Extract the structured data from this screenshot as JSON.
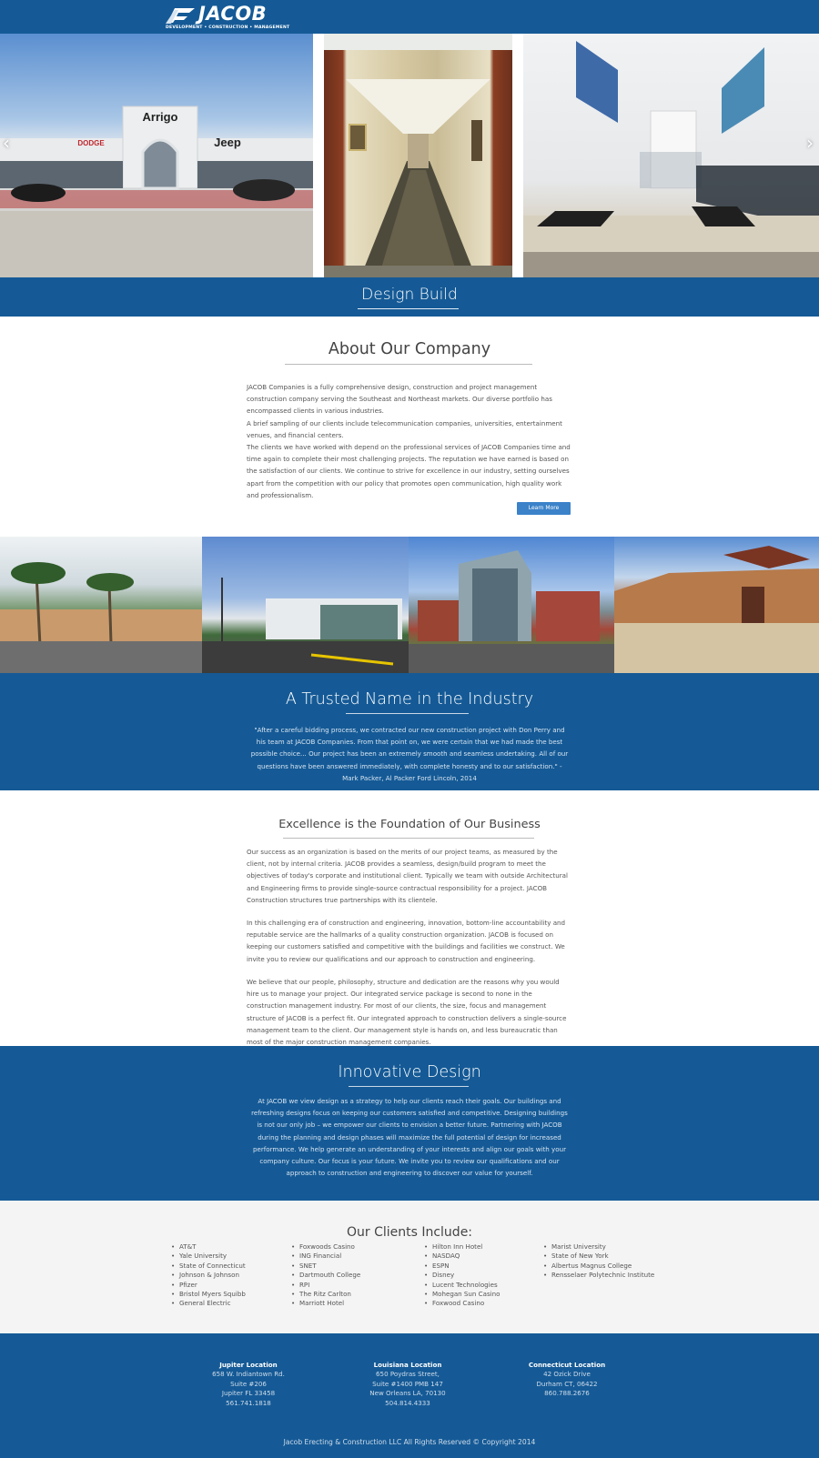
{
  "header": {
    "logo_text": "JACOB",
    "logo_tagline": "DEVELOPMENT • CONSTRUCTION • MANAGEMENT"
  },
  "hero": {
    "prev_icon": "chevron-left-icon",
    "next_icon": "chevron-right-icon",
    "banner": "Design Build",
    "images": [
      {
        "name": "dealership-photo",
        "signs": [
          "Arrigo",
          "DODGE",
          "Jeep"
        ]
      },
      {
        "name": "corridor-photo"
      },
      {
        "name": "lobby-photo"
      }
    ]
  },
  "about": {
    "title": "About Our Company",
    "text": "JACOB Companies is a fully comprehensive design, construction and project management construction company serving the Southeast and Northeast markets. Our diverse portfolio has encompassed clients in various industries.\nA brief sampling of our clients include telecommunication companies, universities, entertainment venues, and financial centers.\nThe clients we have worked with depend on the professional services of JACOB Companies time and time again to complete their most challenging projects. The reputation we have earned is based on the satisfaction of our clients. We continue to strive for excellence in our industry, setting ourselves apart from the competition with our policy that promotes open communication, high quality work and professionalism.",
    "button": "Learn More"
  },
  "trusted": {
    "title": "A Trusted Name in the Industry",
    "quote": "\"After a careful bidding process, we contracted our new construction project with Don Perry and his team at JACOB Companies. From that point on, we were certain that we had made the best possible choice... Our project has been an extremely smooth and seamless undertaking. All of our questions have been answered immediately, with complete honesty and to our satisfaction.\" - Mark Packer, Al Packer Ford Lincoln, 2014"
  },
  "excellence": {
    "title": "Excellence is the Foundation of Our Business",
    "p1": "Our success as an organization is based on the merits of our project teams, as measured by the client, not by internal criteria. JACOB provides a seamless, design/build program to meet the objectives of today's corporate and institutional client. Typically we team with outside Architectural and Engineering firms to provide single-source contractual responsibility for a project. JACOB Construction structures true partnerships with its clientele.",
    "p2": "In this challenging era of construction and engineering, innovation, bottom-line accountability and reputable service are the hallmarks of a quality construction organization. JACOB is focused on keeping our customers satisfied and competitive with the buildings and facilities we construct. We invite you to review our qualifications and our approach to construction and engineering.",
    "p3": "We believe that our people, philosophy, structure and dedication are the reasons why you would hire us to manage your project. Our integrated service package is second to none in the construction management industry. For most of our clients, the size, focus and management structure of JACOB is a perfect fit. Our integrated approach to construction delivers a single-source management team to the client. Our management style is hands on, and less bureaucratic than most of the major construction management companies."
  },
  "innovative": {
    "title": "Innovative Design",
    "text": "At JACOB we view design as a strategy to help our clients reach their goals. Our buildings and refreshing designs focus on keeping our customers satisfied and competitive. Designing buildings is not our only job – we empower our clients to envision a better future. Partnering with JACOB during the planning and design phases will maximize the full potential of design for increased performance. We help generate an understanding of your interests and align our goals with your company culture. Our focus is your future. We invite you to review our qualifications and our approach to construction and engineering to discover our value for yourself."
  },
  "clients": {
    "title": "Our Clients Include:",
    "columns": [
      [
        "AT&T",
        "Yale University",
        "State of Connecticut",
        "Johnson & Johnson",
        "Pfizer",
        "Bristol Myers Squibb",
        "General Electric"
      ],
      [
        "Foxwoods Casino",
        "ING Financial",
        "SNET",
        "Dartmouth College",
        "RPI",
        "The Ritz Carlton",
        "Marriott Hotel"
      ],
      [
        "Hilton Inn Hotel",
        "NASDAQ",
        "ESPN",
        "Disney",
        "Lucent Technologies",
        "Mohegan Sun Casino",
        "Foxwood Casino"
      ],
      [
        "Marist University",
        "State of New York",
        "Albertus Magnus College",
        "Rensselaer Polytechnic Institute"
      ]
    ]
  },
  "footer": {
    "locations": [
      {
        "title": "Jupiter Location",
        "lines": [
          "658 W. Indiantown Rd.",
          "Suite #206",
          "Jupiter FL 33458",
          "561.741.1818"
        ]
      },
      {
        "title": "Louisiana Location",
        "lines": [
          "650 Poydras Street,",
          "Suite #1400 PMB 147",
          "New Orleans LA, 70130",
          "504.814.4333"
        ]
      },
      {
        "title": "Connecticut Location",
        "lines": [
          "42 Ozick Drive",
          "Durham CT, 06422",
          "860.788.2676"
        ]
      }
    ],
    "copyright": "Jacob Erecting & Construction LLC All Rights Reserved © Copyright 2014"
  },
  "colors": {
    "brand_blue": "#155a96",
    "button_blue": "#3b82c9",
    "light_gray": "#f4f4f4"
  }
}
